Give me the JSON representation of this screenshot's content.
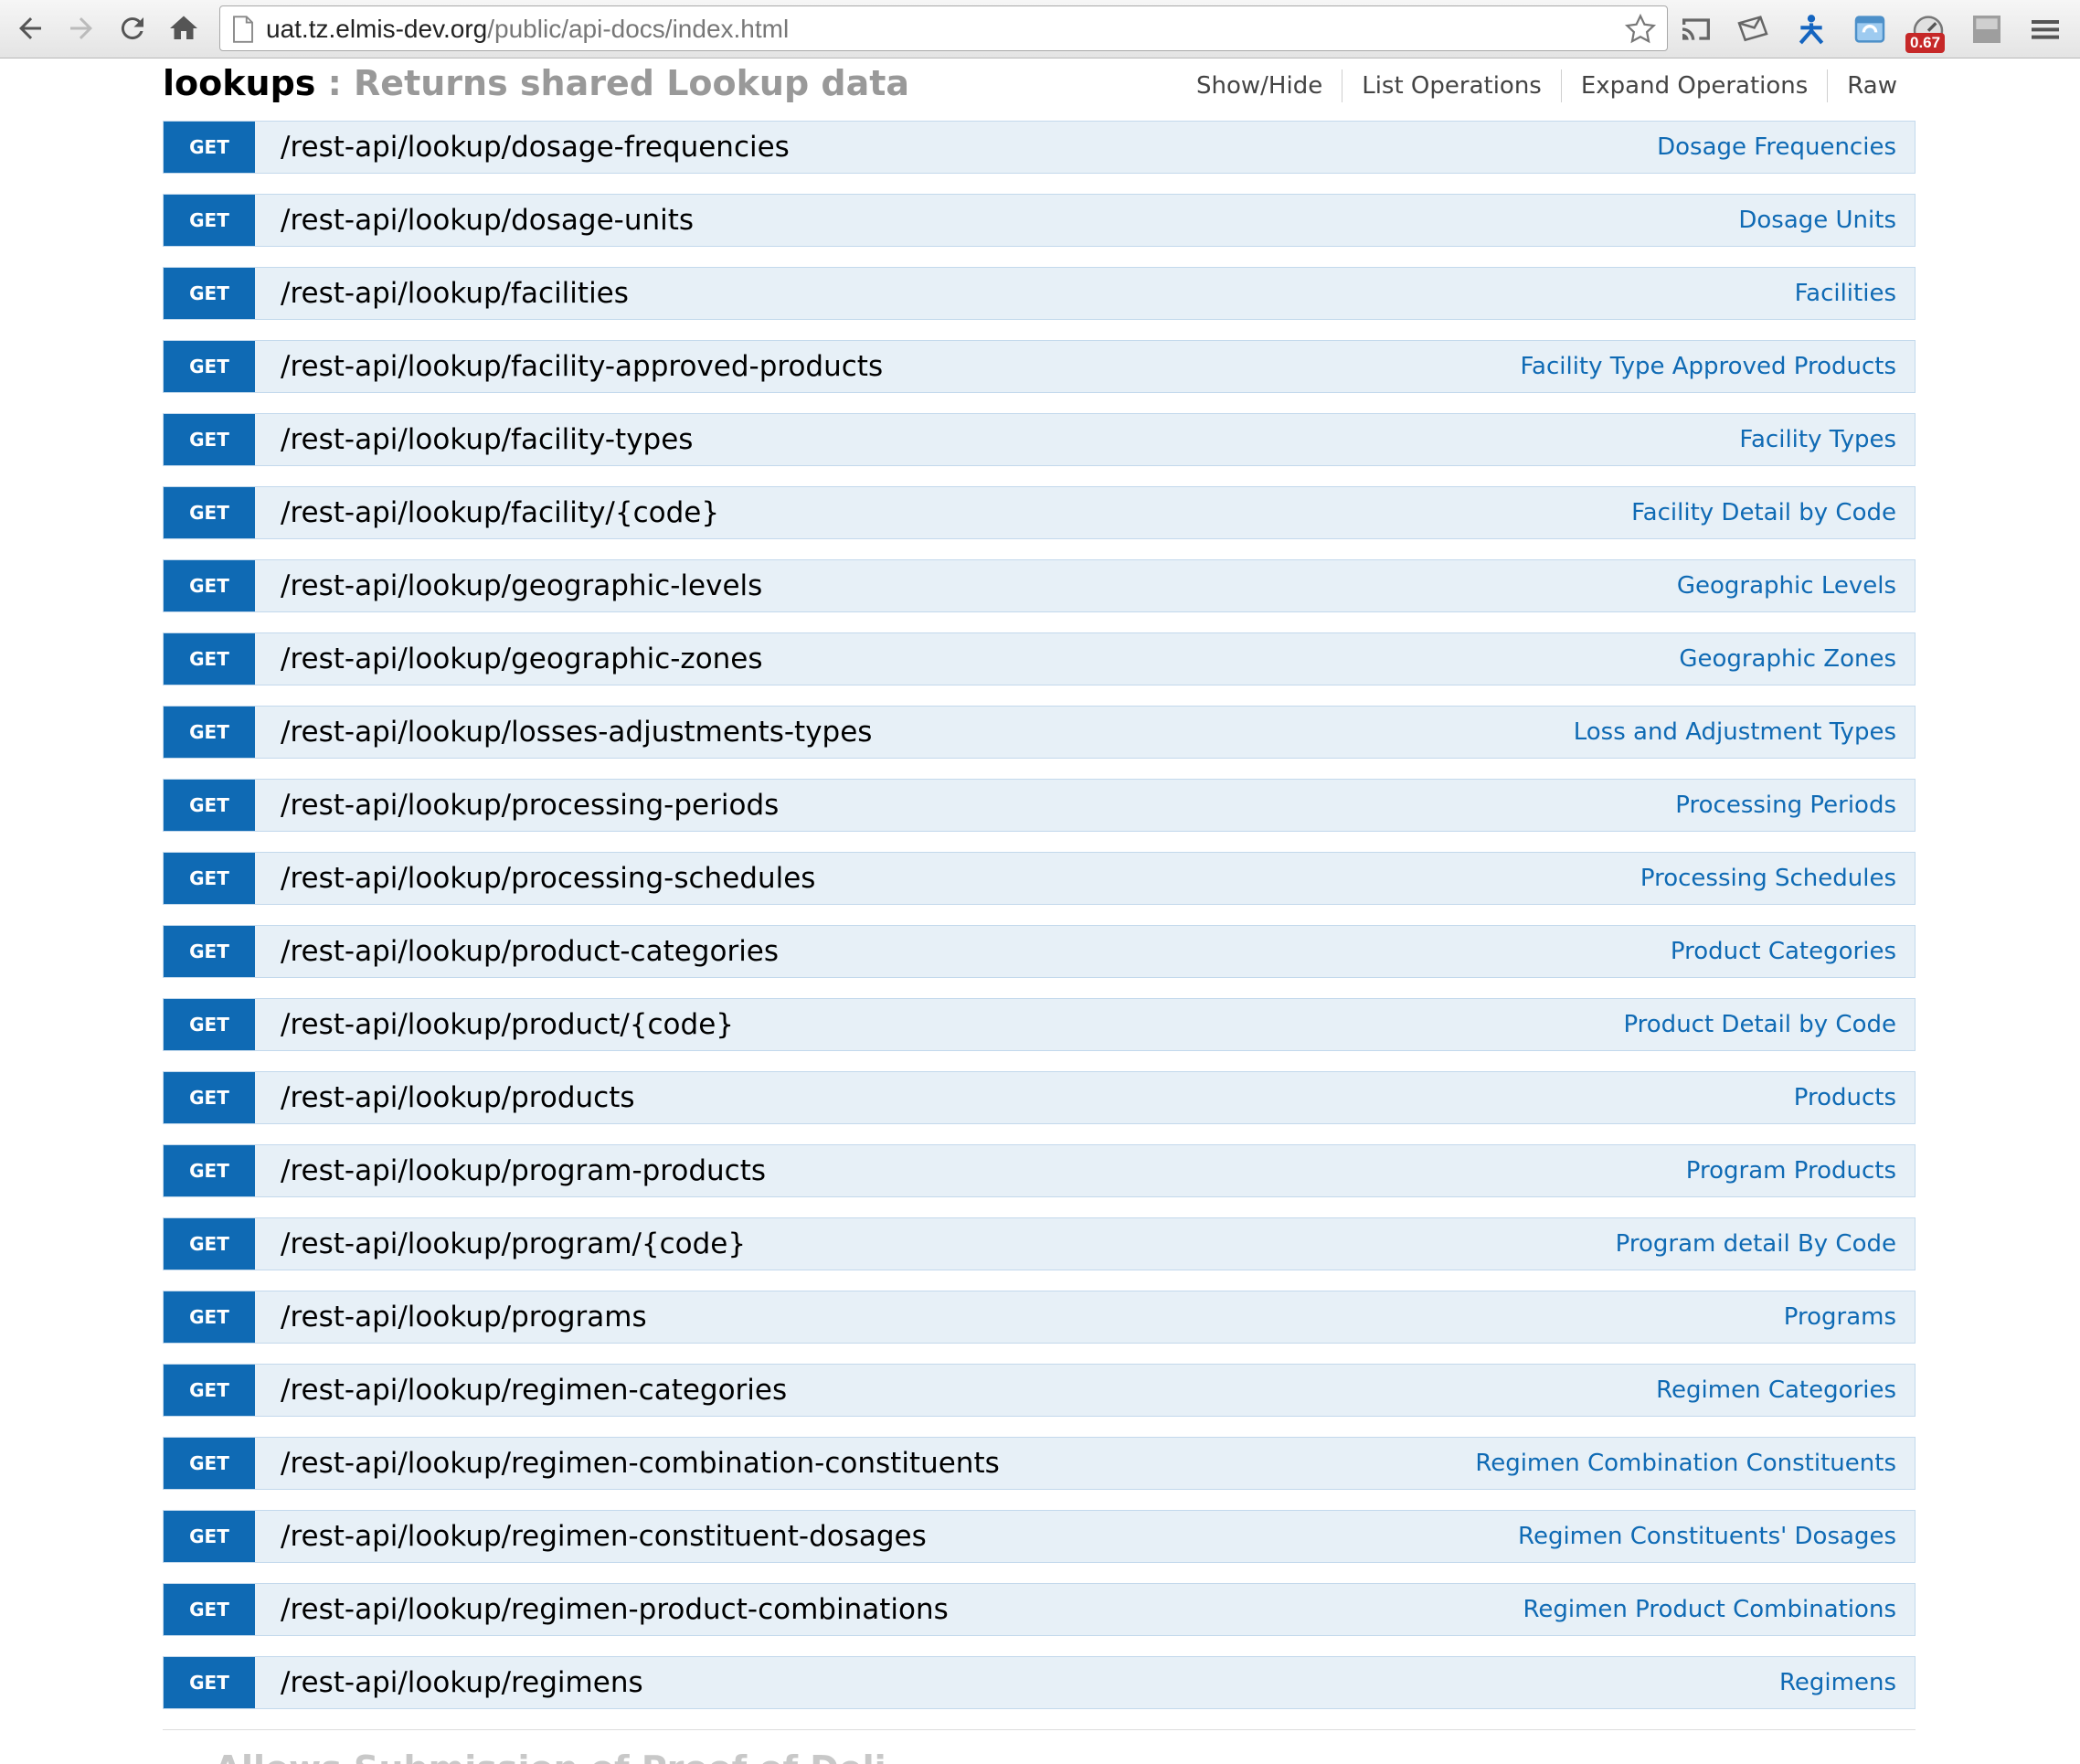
{
  "browser": {
    "url_host": "uat.tz.elmis-dev.org",
    "url_path": "/public/api-docs/index.html",
    "extension_badge": "0.67"
  },
  "resource": {
    "name": "lookups",
    "separator": " : ",
    "description": "Returns shared Lookup data",
    "actions": [
      "Show/Hide",
      "List Operations",
      "Expand Operations",
      "Raw"
    ]
  },
  "endpoints": [
    {
      "method": "GET",
      "path": "/rest-api/lookup/dosage-frequencies",
      "summary": "Dosage Frequencies"
    },
    {
      "method": "GET",
      "path": "/rest-api/lookup/dosage-units",
      "summary": "Dosage Units"
    },
    {
      "method": "GET",
      "path": "/rest-api/lookup/facilities",
      "summary": "Facilities"
    },
    {
      "method": "GET",
      "path": "/rest-api/lookup/facility-approved-products",
      "summary": "Facility Type Approved Products"
    },
    {
      "method": "GET",
      "path": "/rest-api/lookup/facility-types",
      "summary": "Facility Types"
    },
    {
      "method": "GET",
      "path": "/rest-api/lookup/facility/{code}",
      "summary": "Facility Detail by Code"
    },
    {
      "method": "GET",
      "path": "/rest-api/lookup/geographic-levels",
      "summary": "Geographic Levels"
    },
    {
      "method": "GET",
      "path": "/rest-api/lookup/geographic-zones",
      "summary": "Geographic Zones"
    },
    {
      "method": "GET",
      "path": "/rest-api/lookup/losses-adjustments-types",
      "summary": "Loss and Adjustment Types"
    },
    {
      "method": "GET",
      "path": "/rest-api/lookup/processing-periods",
      "summary": "Processing Periods"
    },
    {
      "method": "GET",
      "path": "/rest-api/lookup/processing-schedules",
      "summary": "Processing Schedules"
    },
    {
      "method": "GET",
      "path": "/rest-api/lookup/product-categories",
      "summary": "Product Categories"
    },
    {
      "method": "GET",
      "path": "/rest-api/lookup/product/{code}",
      "summary": "Product Detail by Code"
    },
    {
      "method": "GET",
      "path": "/rest-api/lookup/products",
      "summary": "Products"
    },
    {
      "method": "GET",
      "path": "/rest-api/lookup/program-products",
      "summary": "Program Products"
    },
    {
      "method": "GET",
      "path": "/rest-api/lookup/program/{code}",
      "summary": "Program detail By Code"
    },
    {
      "method": "GET",
      "path": "/rest-api/lookup/programs",
      "summary": "Programs"
    },
    {
      "method": "GET",
      "path": "/rest-api/lookup/regimen-categories",
      "summary": "Regimen Categories"
    },
    {
      "method": "GET",
      "path": "/rest-api/lookup/regimen-combination-constituents",
      "summary": "Regimen Combination Constituents"
    },
    {
      "method": "GET",
      "path": "/rest-api/lookup/regimen-constituent-dosages",
      "summary": "Regimen Constituents' Dosages"
    },
    {
      "method": "GET",
      "path": "/rest-api/lookup/regimen-product-combinations",
      "summary": "Regimen Product Combinations"
    },
    {
      "method": "GET",
      "path": "/rest-api/lookup/regimens",
      "summary": "Regimens"
    }
  ],
  "next_resource_partial": "... Allows Submission of Proof of Deli..."
}
